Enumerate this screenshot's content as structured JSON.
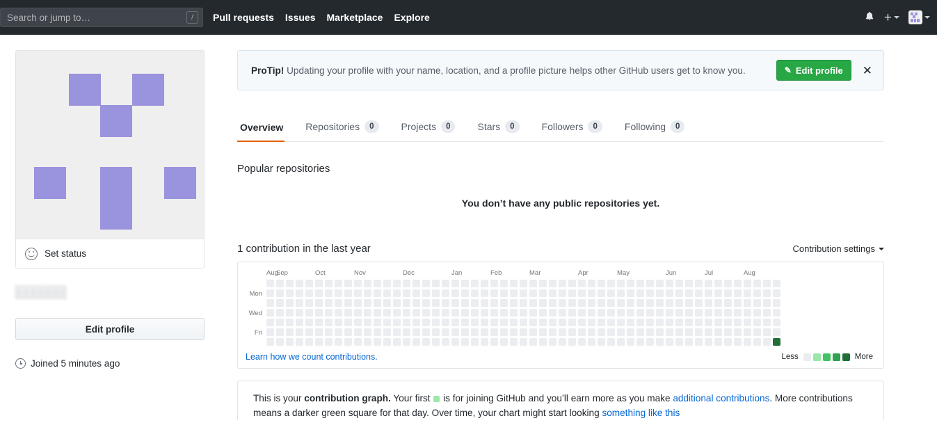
{
  "header": {
    "search": {
      "placeholder": "Search or jump to…",
      "shortcut": "/"
    },
    "nav": [
      {
        "label": "Pull requests"
      },
      {
        "label": "Issues"
      },
      {
        "label": "Marketplace"
      },
      {
        "label": "Explore"
      }
    ],
    "icons": {
      "notifications": "bell-icon",
      "create_new": "plus-icon",
      "create_caret": "chevron-down-icon",
      "avatar": "avatar-icon",
      "avatar_caret": "chevron-down-icon"
    },
    "background_color": "#24292e"
  },
  "sidebar": {
    "avatar_alt": "default-identicon-avatar",
    "avatar_color": "#9a93dd",
    "avatar_bg": "#efefef",
    "set_status": {
      "label": "Set status",
      "icon": "smiley-icon"
    },
    "username": "░░░░░░░",
    "edit_profile_label": "Edit profile",
    "joined": {
      "icon": "clock-icon",
      "text": "Joined 5 minutes ago"
    }
  },
  "protip": {
    "prefix": "ProTip!",
    "message": " Updating your profile with your name, location, and a profile picture helps other GitHub users get to know you.",
    "button": {
      "label": "Edit profile",
      "icon": "pencil-icon",
      "color": "#28a745"
    },
    "dismiss_icon": "close-icon"
  },
  "tabs": [
    {
      "label": "Overview",
      "count": null,
      "active": true
    },
    {
      "label": "Repositories",
      "count": "0",
      "active": false
    },
    {
      "label": "Projects",
      "count": "0",
      "active": false
    },
    {
      "label": "Stars",
      "count": "0",
      "active": false
    },
    {
      "label": "Followers",
      "count": "0",
      "active": false
    },
    {
      "label": "Following",
      "count": "0",
      "active": false
    }
  ],
  "active_tab_accent": "#e36209",
  "popular_repositories": {
    "title": "Popular repositories",
    "empty_message": "You don’t have any public repositories yet."
  },
  "contributions": {
    "title": "1 contribution in the last year",
    "settings_label": "Contribution settings",
    "settings_caret": "chevron-down-icon",
    "learn_link": "Learn how we count contributions.",
    "legend": {
      "less": "Less",
      "more": "More",
      "colors": [
        "#ebedf0",
        "#9be9a8",
        "#40c463",
        "#30a14e",
        "#216e39"
      ]
    },
    "explainer": {
      "line1_a": "This is your ",
      "line1_b": "contribution graph.",
      "line1_c": " Your first ",
      "line1_d": " is for joining GitHub and you’ll earn more as you make ",
      "line1_link": "additional contributions",
      "line1_e": ". More contributions means a darker green square for that day. Over time, your chart might start looking ",
      "line2_link": "something like this"
    }
  },
  "chart_data": {
    "type": "heatmap",
    "title": "1 contribution in the last year",
    "xlabel": "",
    "ylabel": "",
    "month_labels": [
      "Aug",
      "Sep",
      "Oct",
      "Nov",
      "Dec",
      "Jan",
      "Feb",
      "Mar",
      "Apr",
      "May",
      "Jun",
      "Jul",
      "Aug"
    ],
    "month_label_week_index": [
      0,
      1,
      5,
      9,
      14,
      19,
      23,
      27,
      32,
      36,
      41,
      45,
      49
    ],
    "day_labels": [
      "",
      "Mon",
      "",
      "Wed",
      "",
      "Fri",
      ""
    ],
    "weeks": 53,
    "days_per_week": 7,
    "levels": [
      0,
      1,
      2,
      3,
      4
    ],
    "level_colors": [
      "#ebedf0",
      "#9be9a8",
      "#40c463",
      "#30a14e",
      "#216e39"
    ],
    "total_contributions": 1,
    "filled_cells": [
      {
        "week": 52,
        "day": 6,
        "count": 1,
        "level": 4
      }
    ],
    "grid": false,
    "legend": "bottom-right"
  }
}
